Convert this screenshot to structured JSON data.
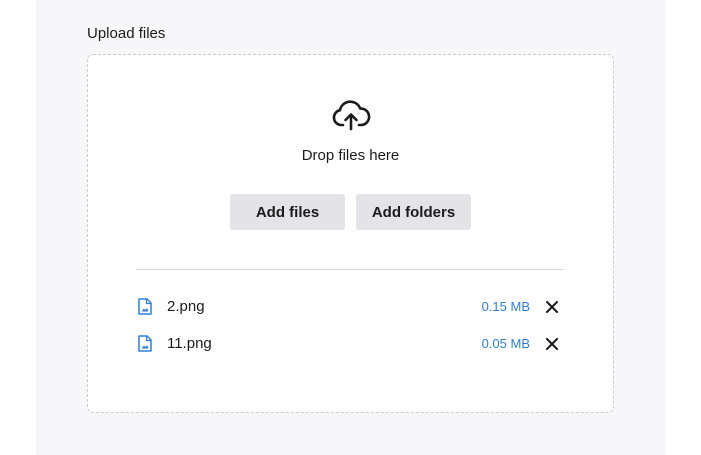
{
  "upload": {
    "label": "Upload files",
    "drop_text": "Drop files here",
    "add_files_label": "Add files",
    "add_folders_label": "Add folders"
  },
  "files": [
    {
      "name": "2.png",
      "size": "0.15 MB"
    },
    {
      "name": "11.png",
      "size": "0.05 MB"
    }
  ],
  "icons": {
    "upload": "cloud-upload-icon",
    "file": "image-file-icon",
    "remove": "close-icon"
  },
  "colors": {
    "accent": "#2f7fdc",
    "button_bg": "#e3e3e8",
    "panel_bg": "#f7f7f9"
  }
}
